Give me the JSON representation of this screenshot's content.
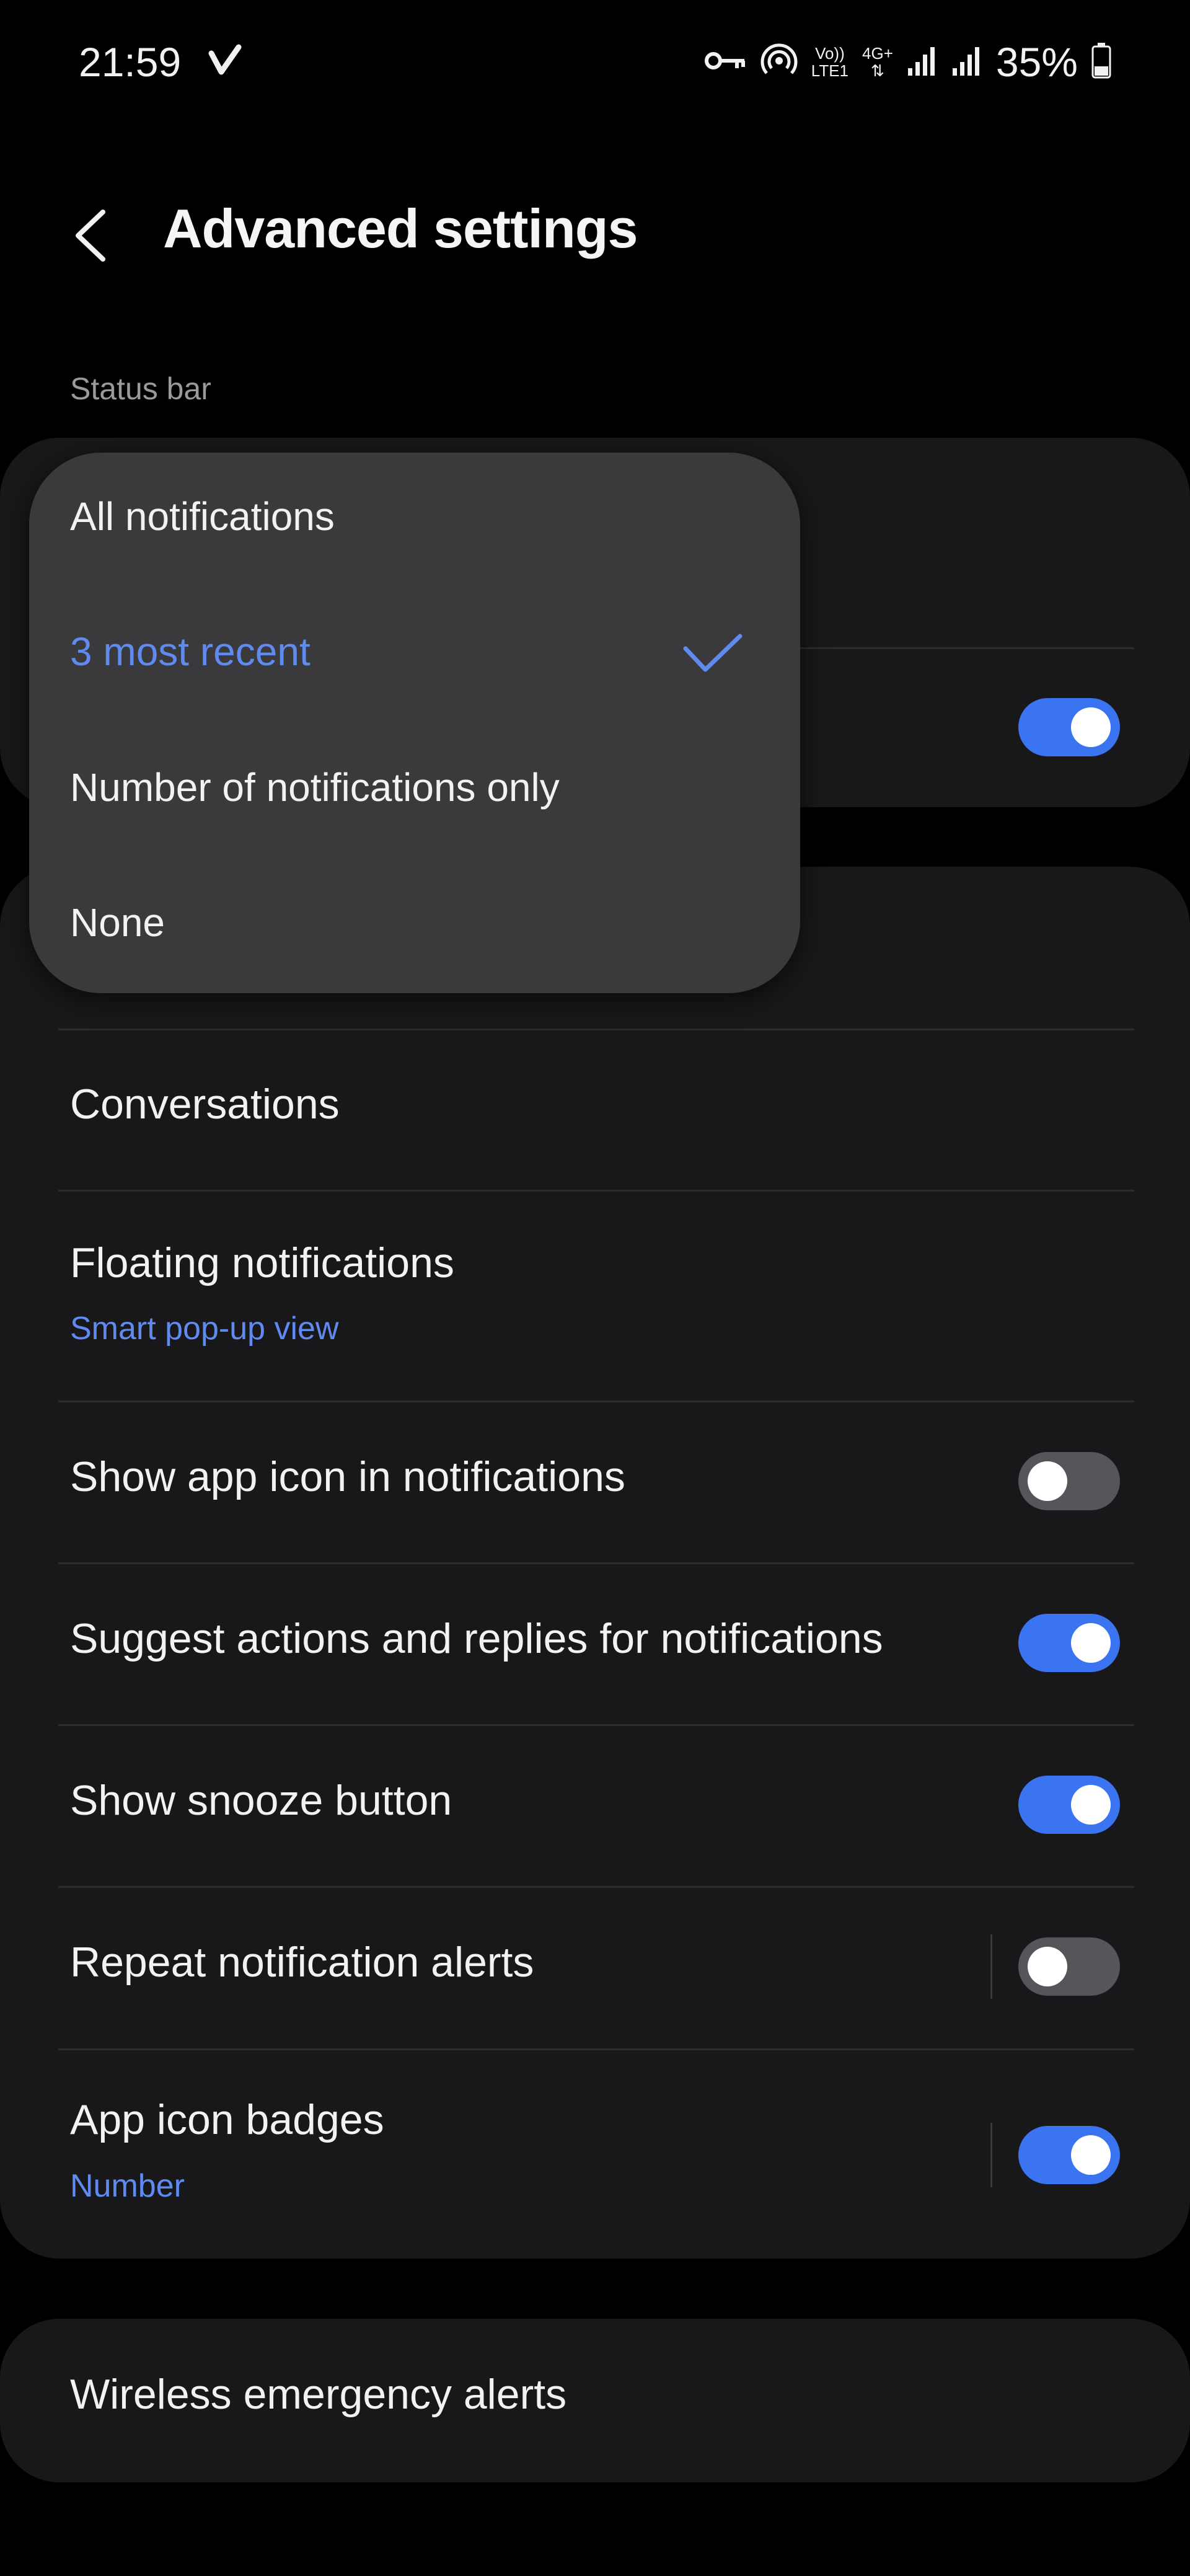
{
  "status_bar": {
    "time": "21:59",
    "volte_top": "Vo))",
    "volte_bottom": "LTE1",
    "network": "4G+",
    "battery": "35%",
    "icons": [
      "check-v-icon",
      "key-icon",
      "hotspot-icon",
      "signal-icon",
      "signal-icon",
      "battery-icon"
    ]
  },
  "header": {
    "title": "Advanced settings"
  },
  "section": {
    "status_bar_label": "Status bar"
  },
  "dropdown": {
    "options": [
      {
        "label": "All notifications",
        "selected": false
      },
      {
        "label": "3 most recent",
        "selected": true
      },
      {
        "label": "Number of notifications only",
        "selected": false
      },
      {
        "label": "None",
        "selected": false
      }
    ]
  },
  "card1": {
    "toggle_on": true
  },
  "settings": {
    "conversations": {
      "title": "Conversations"
    },
    "floating": {
      "title": "Floating notifications",
      "subtitle": "Smart pop-up view"
    },
    "show_app_icon": {
      "title": "Show app icon in notifications",
      "on": false
    },
    "suggest_actions": {
      "title": "Suggest actions and replies for notifications",
      "on": true
    },
    "snooze": {
      "title": "Show snooze button",
      "on": true
    },
    "repeat": {
      "title": "Repeat notification alerts",
      "on": false
    },
    "badges": {
      "title": "App icon badges",
      "subtitle": "Number",
      "on": true
    }
  },
  "emergency": {
    "title": "Wireless emergency alerts"
  },
  "colors": {
    "accent": "#3a74f0",
    "accent_text": "#5f8bf0",
    "background": "#000000",
    "card": "#18181b",
    "dropdown": "#3a3a3c"
  }
}
